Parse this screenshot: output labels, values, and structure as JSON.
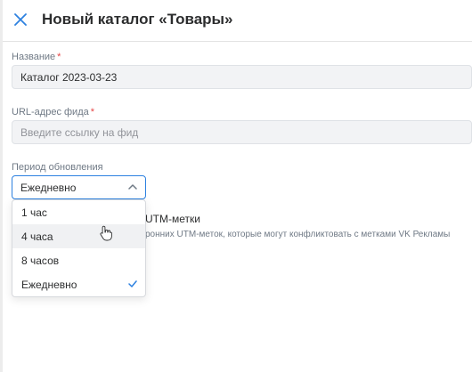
{
  "header": {
    "title": "Новый каталог «Товары»",
    "close_icon": "close-icon",
    "accent_color": "#2d81e0"
  },
  "form": {
    "name": {
      "label": "Название",
      "required_mark": "*",
      "value": "Каталог 2023-03-23"
    },
    "feed_url": {
      "label": "URL-адрес фида",
      "required_mark": "*",
      "placeholder": "Введите ссылку на фид",
      "value": ""
    },
    "period": {
      "label": "Период обновления",
      "selected": "Ежедневно",
      "options": [
        "1 час",
        "4 часа",
        "8 часов",
        "Ежедневно"
      ],
      "hovered_index": 1,
      "checked_index": 3
    },
    "utm": {
      "title_visible": "UTM-метки",
      "description_visible": "ронних UTM-меток, которые могут конфликтовать с метками VK Рекламы"
    }
  }
}
